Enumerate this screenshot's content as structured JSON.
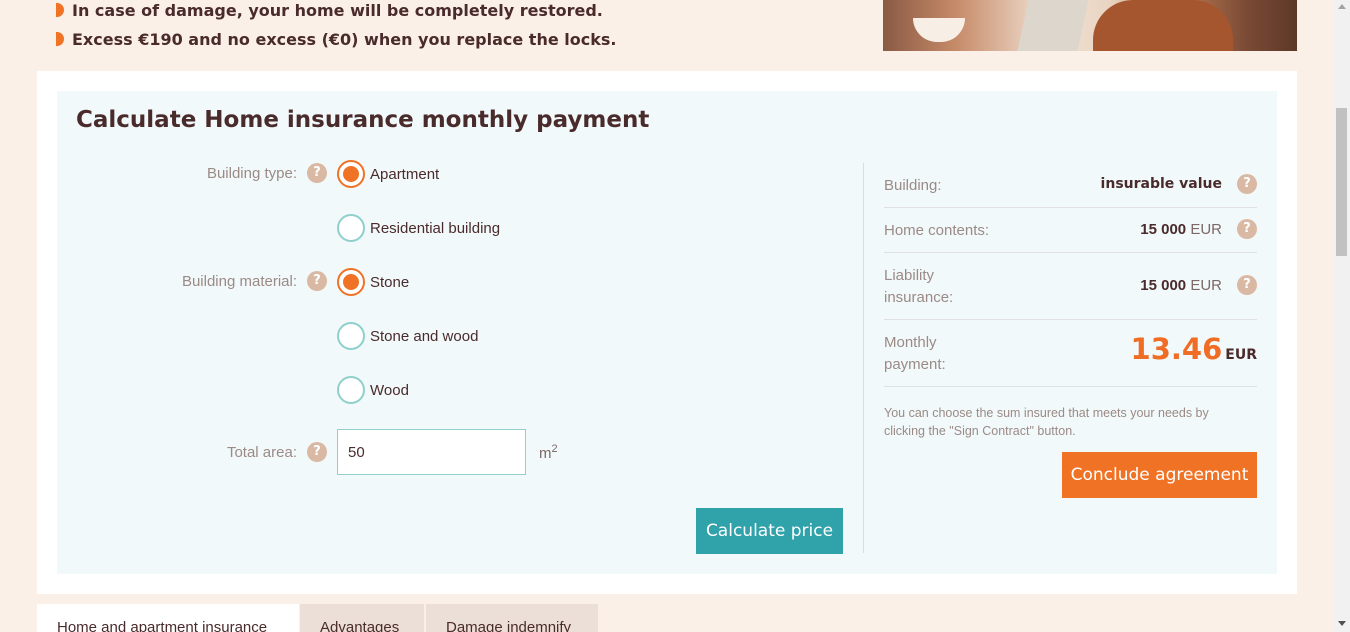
{
  "bullets": [
    "In case of damage, your home will be completely restored.",
    "Excess €190 and no excess (€0) when you replace the locks."
  ],
  "calculator": {
    "title": "Calculate Home insurance monthly payment",
    "building_type": {
      "label": "Building type:",
      "options": [
        "Apartment",
        "Residential building"
      ],
      "selected": "Apartment"
    },
    "building_material": {
      "label": "Building material:",
      "options": [
        "Stone",
        "Stone and wood",
        "Wood"
      ],
      "selected": "Stone"
    },
    "total_area": {
      "label": "Total area:",
      "value": "50",
      "unit": "m",
      "unit_sup": "2"
    },
    "calculate_button": "Calculate price",
    "help_glyph": "?"
  },
  "summary": {
    "building": {
      "label": "Building:",
      "value": "insurable value"
    },
    "home_contents": {
      "label": "Home contents:",
      "amount": "15 000",
      "currency": "EUR"
    },
    "liability": {
      "label_line1": "Liability",
      "label_line2": "insurance:",
      "amount": "15 000",
      "currency": "EUR"
    },
    "monthly": {
      "label_line1": "Monthly",
      "label_line2": "payment:",
      "amount": "13.46",
      "currency": "EUR"
    },
    "note": "You can choose the sum insured that meets your needs by clicking the \"Sign Contract\" button.",
    "conclude_button": "Conclude agreement"
  },
  "tabs": [
    "Home and apartment insurance",
    "Advantages",
    "Damage indemnify"
  ],
  "colors": {
    "accent_orange": "#ef7225",
    "teal": "#2fa2aa",
    "radio_border": "#8fd0cb",
    "text_dark": "#4a2b2b"
  }
}
